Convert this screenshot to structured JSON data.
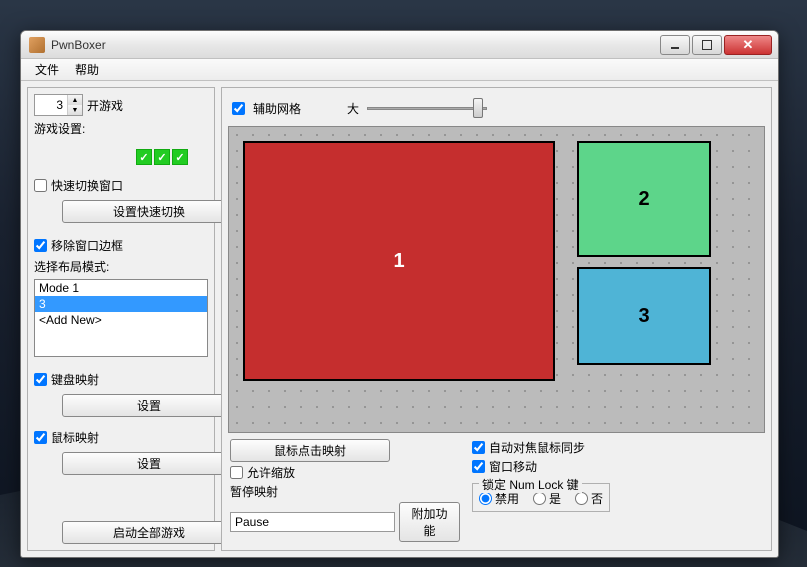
{
  "window": {
    "title": "PwnBoxer"
  },
  "menu": {
    "file": "文件",
    "help": "帮助"
  },
  "left": {
    "spinner_value": "3",
    "open_game_label": "开游戏",
    "game_settings_label": "游戏设置:",
    "fast_switch_label": "快速切换窗口",
    "fast_switch_btn": "设置快速切换",
    "remove_border_label": "移除窗口边框",
    "layout_mode_label": "选择布局模式:",
    "layout_modes": [
      "Mode 1",
      "3",
      "<Add New>"
    ],
    "layout_selected_index": 1,
    "keyboard_map_label": "键盘映射",
    "keyboard_map_btn": "设置",
    "mouse_map_label": "鼠标映射",
    "mouse_map_btn": "设置",
    "start_all_btn": "启动全部游戏"
  },
  "right": {
    "aux_grid_label": "辅助网格",
    "grid_size_label": "大",
    "boxes": [
      {
        "id": "1",
        "color": "#c52e2e"
      },
      {
        "id": "2",
        "color": "#5dd58a"
      },
      {
        "id": "3",
        "color": "#4fb4d6"
      }
    ],
    "mouse_click_map_btn": "鼠标点击映射",
    "allow_zoom_label": "允许缩放",
    "pause_map_label": "暂停映射",
    "pause_value": "Pause",
    "extra_btn": "附加功能",
    "auto_focus_label": "自动对焦鼠标同步",
    "window_move_label": "窗口移动",
    "numlock_legend": "锁定 Num Lock 键",
    "numlock_opts": {
      "disable": "禁用",
      "yes": "是",
      "no": "否"
    }
  }
}
